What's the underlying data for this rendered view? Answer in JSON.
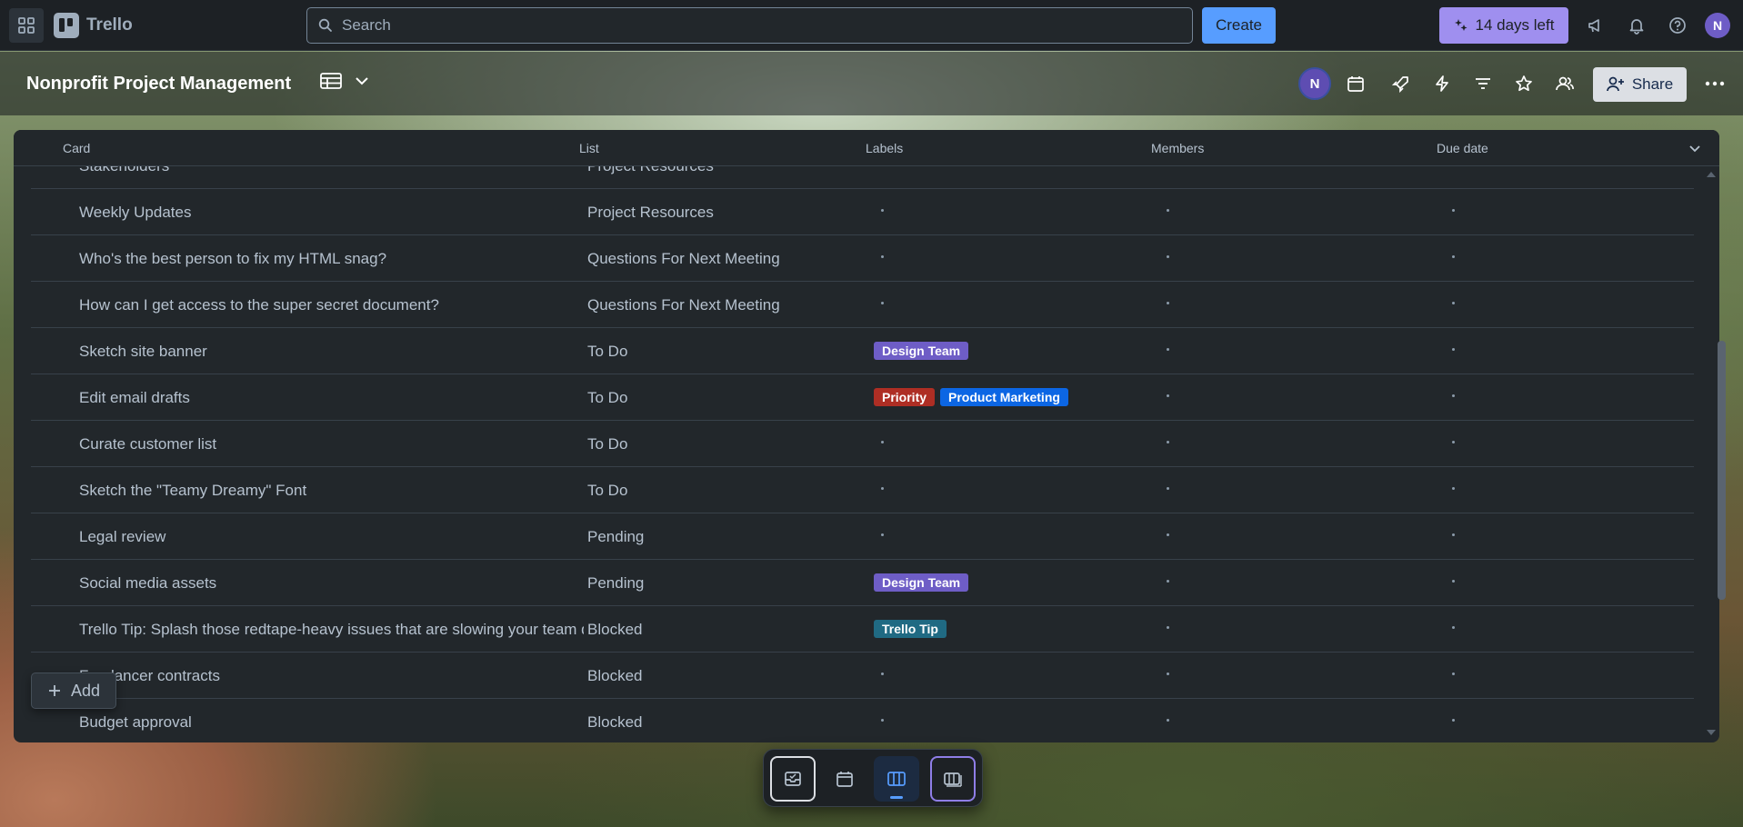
{
  "topbar": {
    "app_name": "Trello",
    "search_placeholder": "Search",
    "create_label": "Create",
    "trial_label": "14 days left",
    "user_initial": "N"
  },
  "board": {
    "title": "Nonprofit Project Management",
    "member_initial": "N",
    "share_label": "Share"
  },
  "table": {
    "columns": [
      "Card",
      "List",
      "Labels",
      "Members",
      "Due date"
    ],
    "rows": [
      {
        "card": "Stakeholders",
        "list": "Project Resources",
        "labels": []
      },
      {
        "card": "Weekly Updates",
        "list": "Project Resources",
        "labels": []
      },
      {
        "card": "Who's the best person to fix my HTML snag?",
        "list": "Questions For Next Meeting",
        "labels": []
      },
      {
        "card": "How can I get access to the super secret document?",
        "list": "Questions For Next Meeting",
        "labels": []
      },
      {
        "card": "Sketch site banner",
        "list": "To Do",
        "labels": [
          {
            "text": "Design Team",
            "color": "#6e5dc6"
          }
        ]
      },
      {
        "card": "Edit email drafts",
        "list": "To Do",
        "labels": [
          {
            "text": "Priority",
            "color": "#ae2e24"
          },
          {
            "text": "Product Marketing",
            "color": "#0c66e4"
          }
        ]
      },
      {
        "card": "Curate customer list",
        "list": "To Do",
        "labels": []
      },
      {
        "card": "Sketch the \"Teamy Dreamy\" Font",
        "list": "To Do",
        "labels": []
      },
      {
        "card": "Legal review",
        "list": "Pending",
        "labels": []
      },
      {
        "card": "Social media assets",
        "list": "Pending",
        "labels": [
          {
            "text": "Design Team",
            "color": "#6e5dc6"
          }
        ]
      },
      {
        "card": "Trello Tip: Splash those redtape-heavy issues that are slowing your team down here",
        "list": "Blocked",
        "labels": [
          {
            "text": "Trello Tip",
            "color": "#206a83"
          }
        ]
      },
      {
        "card": "Freelancer contracts",
        "list": "Blocked",
        "labels": []
      },
      {
        "card": "Budget approval",
        "list": "Blocked",
        "labels": []
      }
    ]
  },
  "add_button": {
    "label": "Add"
  },
  "colors": {
    "topbar_bg": "#1d2125",
    "create_btn": "#579dff",
    "trial_btn": "#9f8fef",
    "panel_bg": "#22272b"
  }
}
